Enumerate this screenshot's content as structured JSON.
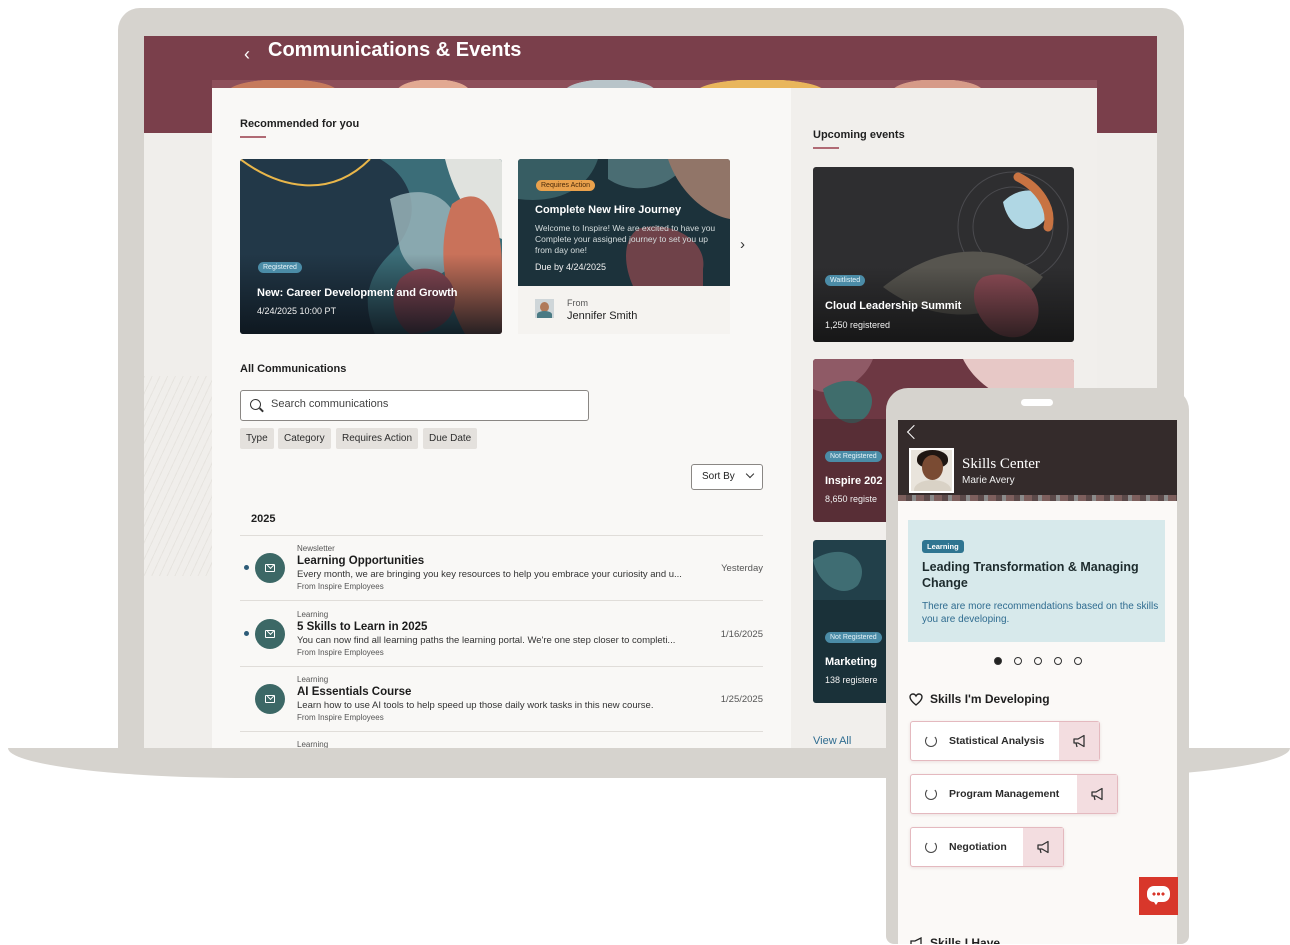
{
  "header": {
    "title": "Communications & Events"
  },
  "recommended": {
    "title": "Recommended for you",
    "cards": [
      {
        "badge": "Registered",
        "title": "New: Career Development and Growth",
        "subtitle": "4/24/2025 10:00 PT"
      },
      {
        "badge": "Requires Action",
        "title": "Complete New Hire Journey",
        "desc": [
          "Welcome to Inspire! We are excited to have you",
          "Complete your assigned journey to set you up",
          "from day one!"
        ],
        "due": "Due by 4/24/2025",
        "from_label": "From",
        "from_name": "Jennifer Smith"
      }
    ]
  },
  "all_communications": {
    "title": "All Communications",
    "search_placeholder": "Search communications",
    "filters": [
      "Type",
      "Category",
      "Requires Action",
      "Due Date"
    ],
    "sort_label": "Sort By",
    "year": "2025",
    "items": [
      {
        "category": "Newsletter",
        "title": "Learning Opportunities",
        "desc": "Every month, we are bringing you key resources to help you embrace your curiosity and u...",
        "from": "From Inspire Employees",
        "date": "Yesterday",
        "unread": true
      },
      {
        "category": "Learning",
        "title": "5 Skills to Learn in 2025",
        "desc": "You can now find all learning paths the learning portal. We're one step closer to completi...",
        "from": "From Inspire Employees",
        "date": "1/16/2025",
        "unread": true
      },
      {
        "category": "Learning",
        "title": "AI Essentials Course",
        "desc": "Learn how to use AI tools to help speed up those daily work tasks in this new course.",
        "from": "From Inspire Employees",
        "date": "1/25/2025",
        "unread": false
      },
      {
        "category": "Learning"
      }
    ]
  },
  "upcoming": {
    "title": "Upcoming events",
    "events": [
      {
        "badge": "Waitlisted",
        "title": "Cloud Leadership Summit",
        "count": "1,250 registered"
      },
      {
        "badge": "Not Registered",
        "title": "Inspire 202",
        "count": "8,650 registe"
      },
      {
        "badge": "Not Registered",
        "title": "Marketing",
        "count": "138 registere"
      }
    ],
    "view_all": "View All"
  },
  "phone": {
    "title": "Skills Center",
    "user": "Marie Avery",
    "recommendation": {
      "badge": "Learning",
      "title": "Leading Transformation & Managing Change",
      "desc": "There are more recommendations based on the skills you are developing."
    },
    "pager": {
      "count": 5,
      "active": 1
    },
    "developing_title": "Skills I'm Developing",
    "skills": [
      "Statistical Analysis",
      "Program Management",
      "Negotiation"
    ],
    "have_title": "Skills I Have"
  },
  "colors": {
    "brand": "#7a3f4b",
    "accent_link": "#2f6c90",
    "badge_blue": "#4b8ca7",
    "chat": "#d8372b"
  },
  "icons": [
    "back-chevron-icon",
    "search-icon",
    "chevron-down-icon",
    "mail-icon",
    "heart-icon",
    "megaphone-icon",
    "chat-icon"
  ]
}
